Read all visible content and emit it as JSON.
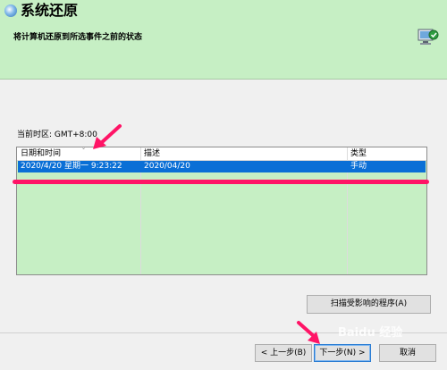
{
  "window": {
    "title": "系统还原"
  },
  "header": {
    "subtitle": "将计算机还原到所选事件之前的状态"
  },
  "timezone_label": "当前时区: GMT+8:00",
  "table": {
    "columns": [
      "日期和时间",
      "描述",
      "类型"
    ],
    "rows": [
      {
        "datetime": "2020/4/20 星期一 9:23:22",
        "description": "2020/04/20",
        "type": "手动"
      }
    ]
  },
  "buttons": {
    "scan": "扫描受影响的程序(A)",
    "back": "< 上一步(B)",
    "next": "下一步(N) >",
    "cancel": "取消"
  },
  "watermark": "Baidu 经验",
  "colors": {
    "header_bg": "#c6efc4",
    "selection": "#0a6fd6",
    "annotation": "#ff1466"
  }
}
